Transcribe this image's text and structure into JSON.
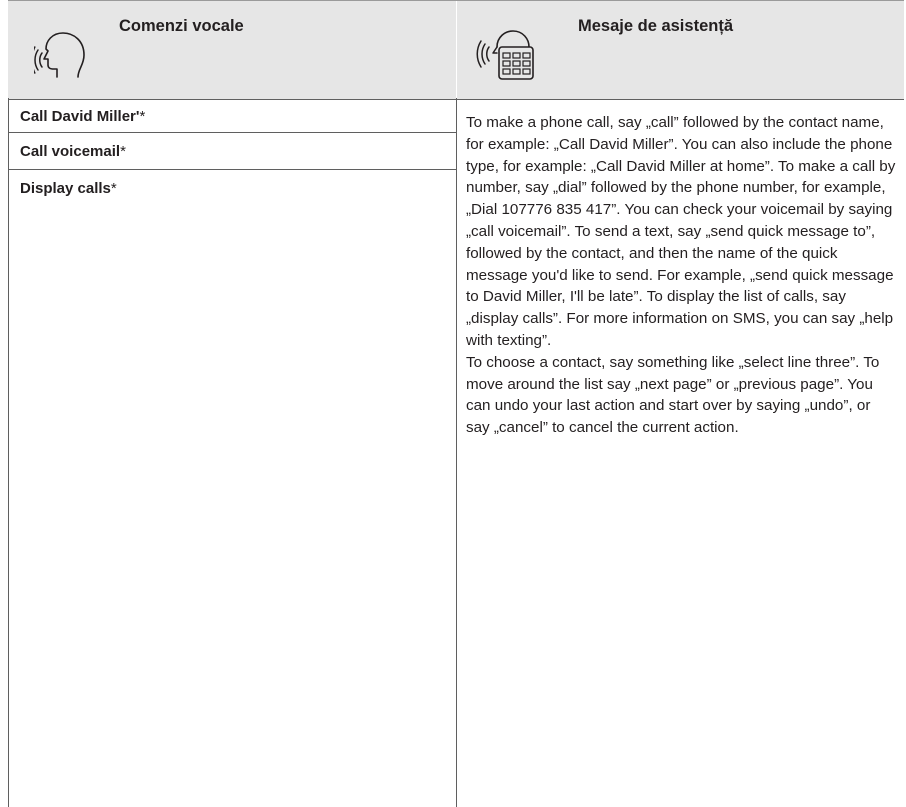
{
  "header": {
    "left_title": "Comenzi vocale",
    "right_title": "Mesaje de asistență",
    "left_icon": "voice-command-icon",
    "right_icon": "voice-help-message-icon"
  },
  "commands": [
    {
      "label": "Call David Miller'",
      "suffix": "*"
    },
    {
      "label": "Call voicemail",
      "suffix": "*"
    },
    {
      "label": "Display calls",
      "suffix": "*"
    }
  ],
  "help": {
    "paragraph1": "To make a phone call, say „call” followed by the contact name, for example: „Call David Miller”. You can also include the phone type, for example: „Call David Miller at home”. To make a call by number, say „dial” followed by the phone number, for example, „Dial 107776 835 417”. You can check your voicemail by saying „call voicemail”. To send a text, say „send quick message to”, followed by the contact, and then the name of the quick message you'd like to send. For example, „send quick message to David Miller, I'll be late”. To display the list of calls, say „display calls”. For more information on SMS, you can say „help with texting”.",
    "paragraph2": "To choose a contact, say something like „select line three”. To move around the list say „next page” or „previous page”. You can undo your last action and start over by saying „undo”, or say „cancel” to cancel the current action."
  }
}
